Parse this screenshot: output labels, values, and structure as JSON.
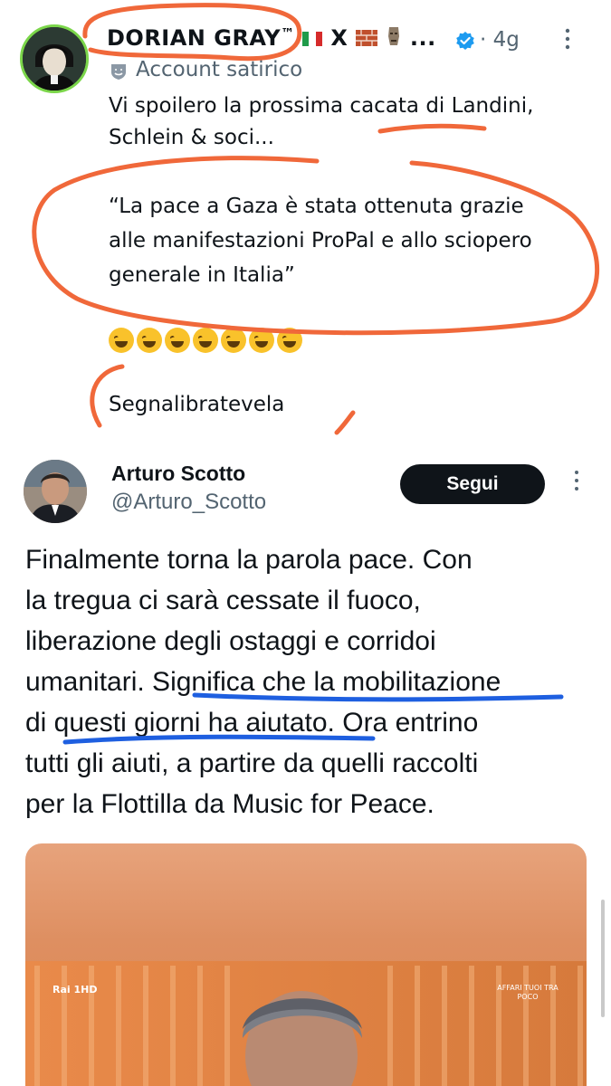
{
  "tweet1": {
    "display_name": "DORIAN GRAY",
    "name_suffix": "™",
    "name_x": "X",
    "name_ellipsis": "...",
    "dot": "·",
    "time": "4g",
    "account_label": "Account satirico",
    "text_line1": "Vi spoilero la prossima cacata di Landini,",
    "text_line2": "Schlein & soci...",
    "quote_line1": "“La pace a Gaza è stata ottenuta grazie",
    "quote_line2": "alle manifestazioni ProPal e allo sciopero",
    "quote_line3": "generale in Italia”",
    "emoji_count": 7,
    "closing": "Segnalibratevela",
    "more_icon": "more-vertical-icon"
  },
  "tweet2": {
    "display_name": "Arturo Scotto",
    "handle": "@Arturo_Scotto",
    "follow_label": "Segui",
    "more_icon": "more-vertical-icon",
    "lines": [
      "Finalmente torna la parola pace. Con",
      "la tregua ci sarà cessate il fuoco,",
      "liberazione degli ostaggi e corridoi",
      "umanitari. Significa che la mobilitazione",
      "di questi giorni ha aiutato. Ora entrino",
      "tutti gli aiuti, a partire da quelli raccolti",
      "per la Flottilla da Music for Peace."
    ],
    "media": {
      "channel_logo": "Rai 1HD",
      "overlay_text": "AFFARI TUOI TRA POCO"
    }
  },
  "colors": {
    "text": "#0f1419",
    "secondary": "#536471",
    "verified_blue": "#1d9bf0",
    "orange_annotation": "#f0683a",
    "blue_annotation": "#1e5fe0",
    "follow_bg": "#0f1419"
  }
}
